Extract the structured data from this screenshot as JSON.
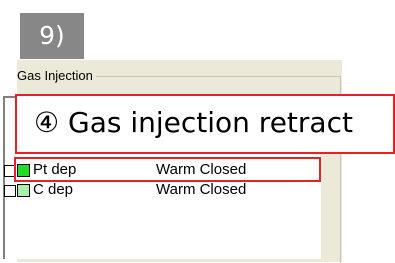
{
  "step_label": "9)",
  "panel": {
    "group_title": "Gas Injection",
    "rows": [
      {
        "name": "Pt dep",
        "status": "Warm Closed",
        "swatch_color": "#22dd22",
        "checked": false
      },
      {
        "name": "C dep",
        "status": "Warm Closed",
        "swatch_color": "#aaeeaa",
        "checked": false
      }
    ]
  },
  "callout": {
    "text": "④ Gas injection retract",
    "border_color": "#e8202a"
  }
}
